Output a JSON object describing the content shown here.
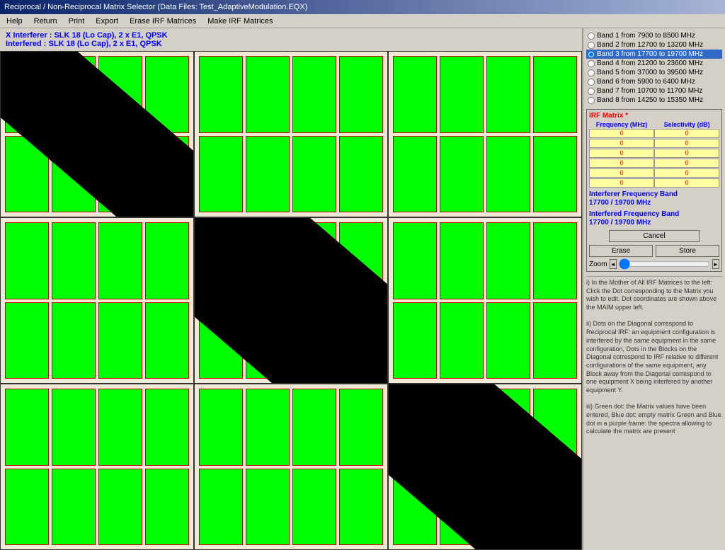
{
  "titleBar": {
    "text": "Reciprocal / Non-Reciprocal Matrix Selector (Data Files: Test_AdaptiveModulation.EQX)"
  },
  "menuBar": {
    "items": [
      "Help",
      "Return",
      "Print",
      "Export",
      "Erase IRF Matrices",
      "Make IRF Matrices"
    ]
  },
  "header": {
    "xInterferer": "X  Interferer : SLK 18 (Lo Cap), 2 x E1, QPSK",
    "interfered": "Interfered : SLK 18 (Lo Cap), 2 x E1, QPSK"
  },
  "bands": [
    {
      "label": "Band 1 from 7900 to 8500 MHz",
      "selected": false
    },
    {
      "label": "Band 2 from 12700 to 13200 MHz",
      "selected": false
    },
    {
      "label": "Band 3 from 17700 to 19700 MHz",
      "selected": true
    },
    {
      "label": "Band 4 from 21200 to 23600 MHz",
      "selected": false
    },
    {
      "label": "Band 5 from 37000 to 39500 MHz",
      "selected": false
    },
    {
      "label": "Band 6 from 5900 to 6400 MHz",
      "selected": false
    },
    {
      "label": "Band 7 from 10700 to 11700 MHz",
      "selected": false
    },
    {
      "label": "Band 8 from 14250 to 15350 MHz",
      "selected": false
    }
  ],
  "irfMatrix": {
    "title": "IRF Matrix *",
    "colHeaders": [
      "Frequency (MHz)",
      "Selectivity (dB)"
    ],
    "rows": [
      {
        "freq": "0",
        "sel": "0"
      },
      {
        "freq": "0",
        "sel": "0"
      },
      {
        "freq": "0",
        "sel": "0"
      },
      {
        "freq": "0",
        "sel": "0"
      },
      {
        "freq": "0",
        "sel": "0"
      },
      {
        "freq": "0",
        "sel": "0"
      }
    ]
  },
  "freqBands": {
    "interfererLabel": "Interferer Frequency Band",
    "interfererValue": "17700 / 19700 MHz",
    "interferedLabel": "Interfered Frequency Band",
    "interferedValue": "17700 / 19700 MHz"
  },
  "buttons": {
    "cancel": "Cancel",
    "erase": "Erase",
    "store": "Store"
  },
  "zoom": {
    "label": "Zoom"
  },
  "helpText": "i) In the Mother of All IRF Matrices to the left: Click the Dot corresponding to the Matrix you wish to edit. Dot coordinates are shown above the MAIM upper left.\n\nii) Dots on the Diagonal correspond to Reciprocal IRF: an equipment configuration is interfered by the same equipment in the same configuration. Dots in the Blocks on the Diagonal correspond to IRF relative to different configurations of the same equipment, any Block away from the Diagonal correspond to one equipment X being interfered by another equipment Y.\n\niii) Green dot: the Matrix values have been entered, Blue dot: empty matrix Green and Blue dot in a purple frame: the spectra allowing to calculate the matrix are present"
}
